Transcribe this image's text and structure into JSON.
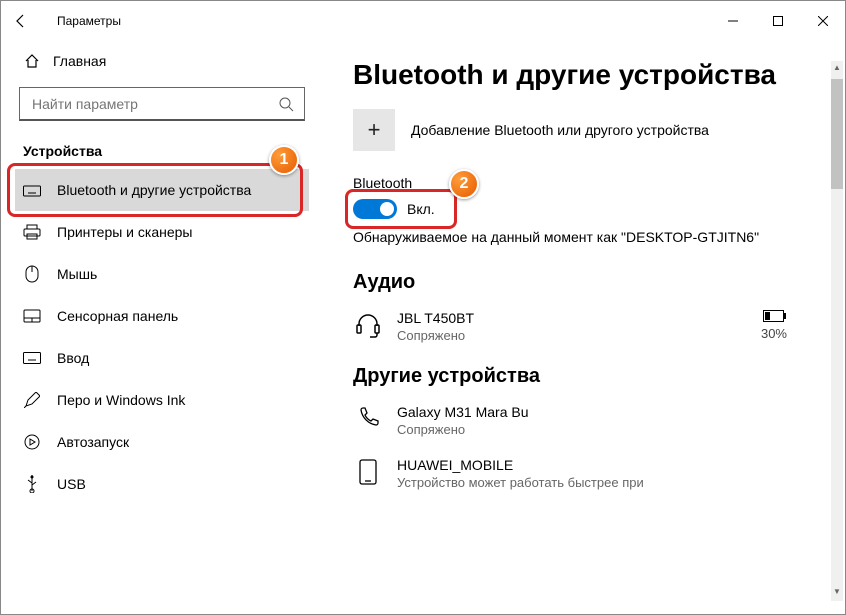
{
  "titlebar": {
    "title": "Параметры"
  },
  "sidebar": {
    "home": "Главная",
    "search_placeholder": "Найти параметр",
    "section": "Устройства",
    "items": [
      "Bluetooth и другие устройства",
      "Принтеры и сканеры",
      "Мышь",
      "Сенсорная панель",
      "Ввод",
      "Перо и Windows Ink",
      "Автозапуск",
      "USB"
    ]
  },
  "main": {
    "title": "Bluetooth и другие устройства",
    "add_label": "Добавление Bluetooth или другого устройства",
    "bt_head": "Bluetooth",
    "toggle_label": "Вкл.",
    "discoverable": "Обнаруживаемое на данный момент как \"DESKTOP-GTJITN6\"",
    "audio_head": "Аудио",
    "audio_device": {
      "name": "JBL T450BT",
      "status": "Сопряжено",
      "battery": "30%"
    },
    "other_head": "Другие устройства",
    "other_device_1": {
      "name": "Galaxy M31 Mara Bu",
      "status": "Сопряжено"
    },
    "other_device_2": {
      "name": "HUAWEI_MOBILE",
      "status": "Устройство может работать быстрее при"
    }
  },
  "markers": {
    "one": "1",
    "two": "2"
  }
}
